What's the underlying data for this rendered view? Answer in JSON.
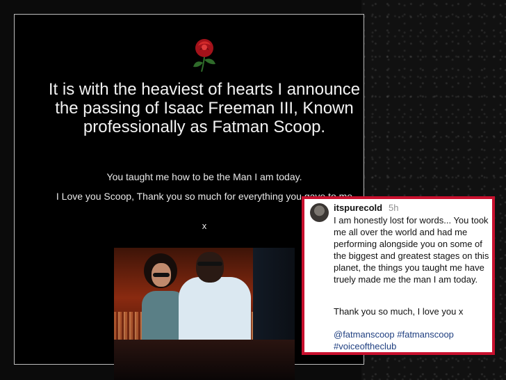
{
  "memorial": {
    "icon": "rose-icon",
    "headline": "It is with the heaviest of hearts I announce the passing of Isaac Freeman III, Known professionally as Fatman Scoop.",
    "line1": "You taught me how to be the Man I am today.",
    "line2": "I Love you Scoop, Thank you so much for everything you gave to me",
    "signoff": "x"
  },
  "post": {
    "username": "itspurecold",
    "time": "5h",
    "body": "I am honestly lost for words... You took me all over the world and had me performing alongside you on some of the biggest and greatest stages on this planet, the things you taught me have truely made me the man I am today.",
    "thanks": "Thank you so much, I love you x",
    "tags": "@fatmanscoop #fatmanscoop #voiceoftheclub",
    "border_color": "#c8102e",
    "tag_color": "#1f3f80"
  }
}
